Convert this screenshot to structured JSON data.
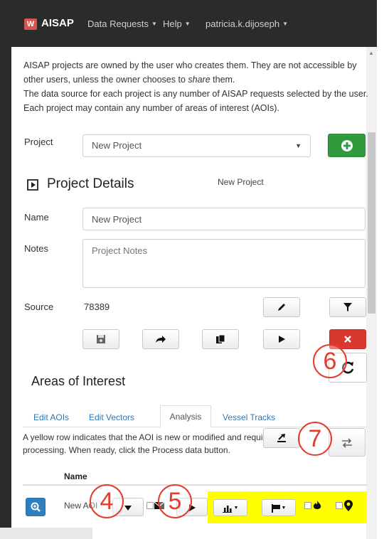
{
  "navbar": {
    "logo_text": "W",
    "brand": "AISAP",
    "items": [
      {
        "label": "Data Requests"
      },
      {
        "label": "Help"
      },
      {
        "label": "patricia.k.dijoseph"
      }
    ]
  },
  "intro": {
    "line1": "AISAP projects are owned by the user who creates them. They are not accessible by other users, unless the owner chooses to ",
    "share_word": "share",
    "line1_end": " them.",
    "line2": "The data source for each project is any number of AISAP requests selected by the user. Each project may contain any number of areas of interest (AOIs)."
  },
  "project_select": {
    "label": "Project",
    "value": "New Project"
  },
  "project_details": {
    "title": "Project Details",
    "current_name": "New Project",
    "name_label": "Name",
    "name_value": "New Project",
    "notes_label": "Notes",
    "notes_placeholder": "Project Notes",
    "source_label": "Source",
    "source_value": "78389"
  },
  "aoi": {
    "title": "Areas of Interest",
    "tabs": [
      {
        "label": "Edit AOIs"
      },
      {
        "label": "Edit Vectors"
      },
      {
        "label": "Analysis"
      },
      {
        "label": "Vessel Tracks"
      }
    ],
    "help": "A yellow row indicates that the AOI is new or modified and requires processing. When ready, click the Process data button.",
    "column_name": "Name",
    "row_name": "New AOI"
  },
  "markers": [
    "4",
    "5",
    "6",
    "7"
  ],
  "colors": {
    "navbar_bg": "#2b2b2b",
    "add_green": "#2f9b3c",
    "delete_red": "#d9382f",
    "zoom_blue": "#2f7fbf",
    "pending_yellow": "#ffff00",
    "marker_red": "#e53b2e",
    "tab_link": "#2e75b6"
  }
}
